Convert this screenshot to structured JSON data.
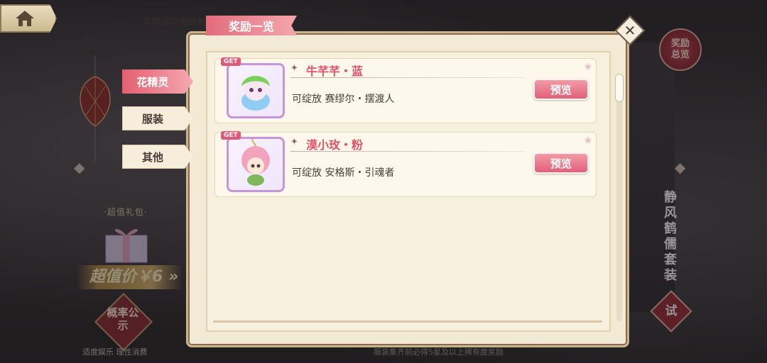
{
  "top": {
    "countdown_text": "本期活动倒计时",
    "home_icon": "home-icon"
  },
  "left_panel": {
    "gift_label": "·超值礼包·",
    "price_text": "超值价￥6 »",
    "probability_label": "概率公示",
    "footer_text": "适度娱乐 理性消费"
  },
  "right_panel": {
    "reward_overview_label": "奖励总览",
    "suit_name": "静风鹤儒套装",
    "try_label": "试"
  },
  "footer_notice": "服装集齐前必得5星及以上稀有度奖励",
  "modal": {
    "title": "奖励一览",
    "close_icon": "close-icon",
    "tabs": [
      {
        "label": "花精灵",
        "active": true
      },
      {
        "label": "服装",
        "active": false
      },
      {
        "label": "其他",
        "active": false
      }
    ],
    "items": [
      {
        "get_tag": "GET",
        "name": "牛芊芊・蓝",
        "description": "可绽放 赛缪尔・摆渡人",
        "preview_label": "预览",
        "accent": "#7fc6f0"
      },
      {
        "get_tag": "GET",
        "name": "漠小玫・粉",
        "description": "可绽放 安格斯・引魂者",
        "preview_label": "预览",
        "accent": "#f4a3bd"
      }
    ]
  },
  "colors": {
    "accent_pink": "#e35f70",
    "modal_bg": "#f3ead6",
    "name_red": "#e05467"
  }
}
